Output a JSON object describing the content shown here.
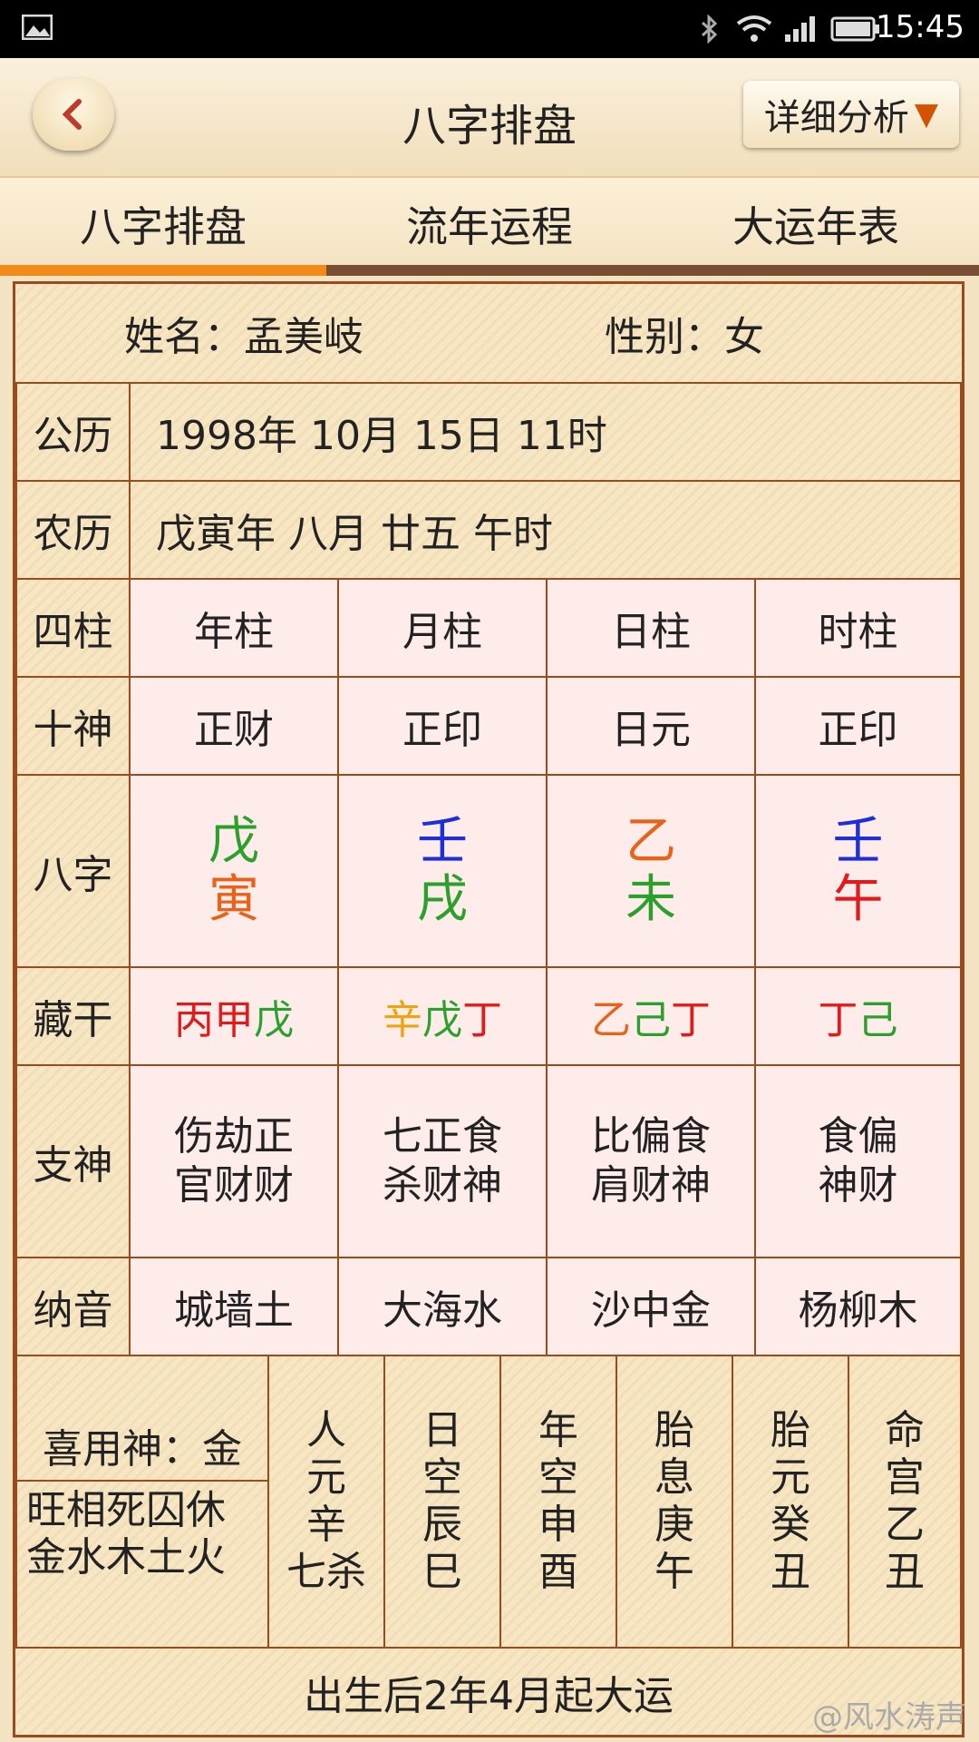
{
  "status": {
    "time": "15:45"
  },
  "appbar": {
    "title": "八字排盘",
    "detail_button": "详细分析"
  },
  "tabs": [
    {
      "label": "八字排盘"
    },
    {
      "label": "流年运程"
    },
    {
      "label": "大运年表"
    }
  ],
  "header": {
    "name_label": "姓名：孟美岐",
    "gender_label": "性别：女"
  },
  "solar": {
    "label": "公历",
    "value": "1998年 10月 15日 11时"
  },
  "lunar": {
    "label": "农历",
    "value": "戊寅年 八月 廿五 午时"
  },
  "table": {
    "pillars_label": "四柱",
    "pillars": [
      "年柱",
      "月柱",
      "日柱",
      "时柱"
    ],
    "ten_gods_label": "十神",
    "ten_gods": [
      "正财",
      "正印",
      "日元",
      "正印"
    ],
    "bazi_label": "八字",
    "bazi": [
      {
        "stem": "戊",
        "stem_color": "#2ca02c",
        "branch": "寅",
        "branch_color": "#e8631a"
      },
      {
        "stem": "壬",
        "stem_color": "#1f2fd6",
        "branch": "戌",
        "branch_color": "#2ca02c"
      },
      {
        "stem": "乙",
        "stem_color": "#e8631a",
        "branch": "未",
        "branch_color": "#2ca02c"
      },
      {
        "stem": "壬",
        "stem_color": "#1f2fd6",
        "branch": "午",
        "branch_color": "#e01b1b"
      }
    ],
    "hidden_label": "藏干",
    "hidden": [
      [
        {
          "c": "丙",
          "color": "#e01b1b"
        },
        {
          "c": "甲",
          "color": "#e01b1b"
        },
        {
          "c": "戊",
          "color": "#2ca02c"
        }
      ],
      [
        {
          "c": "辛",
          "color": "#f0a30a"
        },
        {
          "c": "戊",
          "color": "#2ca02c"
        },
        {
          "c": "丁",
          "color": "#e01b1b"
        }
      ],
      [
        {
          "c": "乙",
          "color": "#e8631a"
        },
        {
          "c": "己",
          "color": "#2ca02c"
        },
        {
          "c": "丁",
          "color": "#e01b1b"
        }
      ],
      [
        {
          "c": "丁",
          "color": "#e01b1b"
        },
        {
          "c": "己",
          "color": "#2ca02c"
        }
      ]
    ],
    "branch_gods_label": "支神",
    "branch_gods": [
      {
        "line1": "伤劫正",
        "line2": "官财财"
      },
      {
        "line1": "七正食",
        "line2": "杀财神"
      },
      {
        "line1": "比偏食",
        "line2": "肩财神"
      },
      {
        "line1": "食偏",
        "line2": "神财"
      }
    ],
    "nayin_label": "纳音",
    "nayin": [
      "城墙土",
      "大海水",
      "沙中金",
      "杨柳木"
    ]
  },
  "bottom": {
    "useful_god": "喜用神：金",
    "season_line1": "旺相死囚休",
    "season_line2": "金水木土火",
    "columns": [
      [
        "人",
        "元",
        "辛",
        "七杀"
      ],
      [
        "日",
        "空",
        "辰",
        "巳"
      ],
      [
        "年",
        "空",
        "申",
        "酉"
      ],
      [
        "胎",
        "息",
        "庚",
        "午"
      ],
      [
        "胎",
        "元",
        "癸",
        "丑"
      ],
      [
        "命",
        "宫",
        "乙",
        "丑"
      ]
    ],
    "fortune_start": "出生后2年4月起大运"
  },
  "watermark": "@风水涛声"
}
